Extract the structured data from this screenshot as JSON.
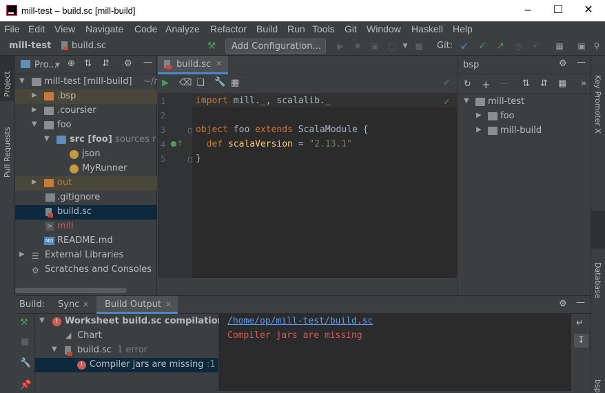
{
  "window": {
    "title": "mill-test – build.sc [mill-build]"
  },
  "menu": [
    "File",
    "Edit",
    "View",
    "Navigate",
    "Code",
    "Analyze",
    "Refactor",
    "Build",
    "Run",
    "Tools",
    "Git",
    "Window",
    "Haskell",
    "Help"
  ],
  "nav": {
    "project": "mill-test",
    "file": "build.sc",
    "add_config": "Add Configuration...",
    "git_label": "Git:"
  },
  "left_tabs": {
    "project": "Project",
    "pull_requests": "Pull Requests"
  },
  "right_tabs": {
    "key_promoter": "Key Promoter X",
    "database": "Database",
    "bsp": "bsp"
  },
  "project_panel": {
    "title": "Pro...",
    "tree": [
      {
        "label": "mill-test [mill-build]",
        "suffix": "~/r",
        "icon": "folder-icon"
      },
      {
        "label": ".bsp",
        "icon": "folder-icon"
      },
      {
        "label": ".coursier",
        "icon": "folder-icon"
      },
      {
        "label": "foo",
        "icon": "folder-icon"
      },
      {
        "label": "src [foo]",
        "suffix": "sources r",
        "icon": "source-folder-icon"
      },
      {
        "label": "json",
        "icon": "object-icon"
      },
      {
        "label": "MyRunner",
        "icon": "object-icon"
      },
      {
        "label": "out",
        "icon": "excluded-folder-icon"
      },
      {
        "label": ".gitignore",
        "icon": "gitignore-file-icon"
      },
      {
        "label": "build.sc",
        "icon": "scala-file-icon"
      },
      {
        "label": "mill",
        "icon": "shell-script-icon"
      },
      {
        "label": "README.md",
        "icon": "markdown-file-icon"
      },
      {
        "label": "External Libraries",
        "icon": "library-icon"
      },
      {
        "label": "Scratches and Consoles",
        "icon": "scratches-icon"
      }
    ]
  },
  "editor": {
    "tab": "build.sc",
    "line_numbers": [
      "1",
      "2",
      "3",
      "4",
      "5"
    ]
  },
  "bsp_panel": {
    "title": "bsp",
    "tree": [
      {
        "label": "mill-test"
      },
      {
        "label": "foo"
      },
      {
        "label": "mill-build"
      }
    ]
  },
  "bottom": {
    "build_label": "Build:",
    "tabs": [
      "Sync",
      "Build Output"
    ],
    "tree": [
      {
        "label": "Worksheet build.sc compilation"
      },
      {
        "label": "Chart"
      },
      {
        "label": "build.sc",
        "suffix": "1 error"
      },
      {
        "label": "Compiler jars are missing",
        "suffix": ":1"
      }
    ],
    "output_link": "/home/op/mill-test/build.sc",
    "output_error": "Compiler jars are missing"
  },
  "colors": {
    "accent": "#4a88c7",
    "error": "#cf5b56",
    "selection": "#0d293e",
    "green": "#499c54"
  }
}
